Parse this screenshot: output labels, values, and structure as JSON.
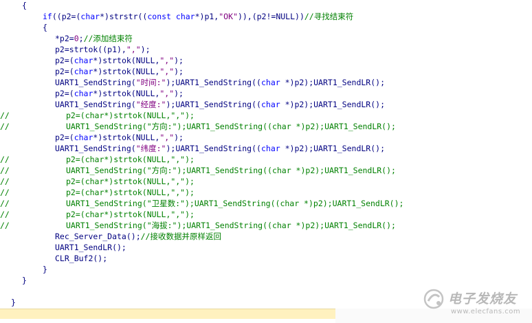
{
  "code_lines": [
    {
      "marker": "",
      "indent": 32,
      "segs": [
        {
          "t": "{",
          "c": "dim"
        }
      ]
    },
    {
      "marker": "",
      "indent": 62,
      "segs": [
        {
          "t": "if",
          "c": "kw"
        },
        {
          "t": "((p2=(",
          "c": "dim"
        },
        {
          "t": "char",
          "c": "kw"
        },
        {
          "t": "*)strstr((",
          "c": "dim"
        },
        {
          "t": "const char",
          "c": "kw"
        },
        {
          "t": "*)p1,",
          "c": "dim"
        },
        {
          "t": "\"OK\"",
          "c": "str"
        },
        {
          "t": ")),(p2!=NULL))",
          "c": "dim"
        },
        {
          "t": "//寻找结束符",
          "c": "cm"
        }
      ]
    },
    {
      "marker": "",
      "indent": 62,
      "segs": [
        {
          "t": "{",
          "c": "dim"
        }
      ]
    },
    {
      "marker": "",
      "indent": 80,
      "segs": [
        {
          "t": "*p2=",
          "c": "dim"
        },
        {
          "t": "0",
          "c": "str"
        },
        {
          "t": ";",
          "c": "dim"
        },
        {
          "t": "//添加结束符",
          "c": "cm"
        }
      ]
    },
    {
      "marker": "",
      "indent": 80,
      "segs": [
        {
          "t": "p2=strtok((p1),",
          "c": "dim"
        },
        {
          "t": "\",\"",
          "c": "str"
        },
        {
          "t": ");",
          "c": "dim"
        }
      ]
    },
    {
      "marker": "",
      "indent": 80,
      "segs": [
        {
          "t": "p2=(",
          "c": "dim"
        },
        {
          "t": "char",
          "c": "kw"
        },
        {
          "t": "*)strtok(NULL,",
          "c": "dim"
        },
        {
          "t": "\",\"",
          "c": "str"
        },
        {
          "t": ");",
          "c": "dim"
        }
      ]
    },
    {
      "marker": "",
      "indent": 80,
      "segs": [
        {
          "t": "p2=(",
          "c": "dim"
        },
        {
          "t": "char",
          "c": "kw"
        },
        {
          "t": "*)strtok(NULL,",
          "c": "dim"
        },
        {
          "t": "\",\"",
          "c": "str"
        },
        {
          "t": ");",
          "c": "dim"
        }
      ]
    },
    {
      "marker": "",
      "indent": 80,
      "segs": [
        {
          "t": "UART1_SendString(",
          "c": "dim"
        },
        {
          "t": "\"时间:\"",
          "c": "str"
        },
        {
          "t": ");UART1_SendString((",
          "c": "dim"
        },
        {
          "t": "char",
          "c": "kw"
        },
        {
          "t": " *)p2);UART1_SendLR();",
          "c": "dim"
        }
      ]
    },
    {
      "marker": "",
      "indent": 80,
      "segs": [
        {
          "t": "p2=(",
          "c": "dim"
        },
        {
          "t": "char",
          "c": "kw"
        },
        {
          "t": "*)strtok(NULL,",
          "c": "dim"
        },
        {
          "t": "\",\"",
          "c": "str"
        },
        {
          "t": ");",
          "c": "dim"
        }
      ]
    },
    {
      "marker": "",
      "indent": 80,
      "segs": [
        {
          "t": "UART1_SendString(",
          "c": "dim"
        },
        {
          "t": "\"经度:\"",
          "c": "str"
        },
        {
          "t": ");UART1_SendString((",
          "c": "dim"
        },
        {
          "t": "char",
          "c": "kw"
        },
        {
          "t": " *)p2);UART1_SendLR();",
          "c": "dim"
        }
      ]
    },
    {
      "marker": "//",
      "indent": 96,
      "segs": [
        {
          "t": "p2=(char*)strtok(NULL,\",\");",
          "c": "cm"
        }
      ]
    },
    {
      "marker": "//",
      "indent": 96,
      "segs": [
        {
          "t": "UART1_SendString(\"方向:\");UART1_SendString((char *)p2);UART1_SendLR();",
          "c": "cm"
        }
      ]
    },
    {
      "marker": "",
      "indent": 80,
      "segs": [
        {
          "t": "p2=(",
          "c": "dim"
        },
        {
          "t": "char",
          "c": "kw"
        },
        {
          "t": "*)strtok(NULL,",
          "c": "dim"
        },
        {
          "t": "\",\"",
          "c": "str"
        },
        {
          "t": ");",
          "c": "dim"
        }
      ]
    },
    {
      "marker": "",
      "indent": 80,
      "segs": [
        {
          "t": "UART1_SendString(",
          "c": "dim"
        },
        {
          "t": "\"纬度:\"",
          "c": "str"
        },
        {
          "t": ");UART1_SendString((",
          "c": "dim"
        },
        {
          "t": "char",
          "c": "kw"
        },
        {
          "t": " *)p2);UART1_SendLR();",
          "c": "dim"
        }
      ]
    },
    {
      "marker": "//",
      "indent": 96,
      "segs": [
        {
          "t": "p2=(char*)strtok(NULL,\",\");",
          "c": "cm"
        }
      ]
    },
    {
      "marker": "//",
      "indent": 96,
      "segs": [
        {
          "t": "UART1_SendString(\"方向:\");UART1_SendString((char *)p2);UART1_SendLR();",
          "c": "cm"
        }
      ]
    },
    {
      "marker": "//",
      "indent": 96,
      "segs": [
        {
          "t": "p2=(char*)strtok(NULL,\",\");",
          "c": "cm"
        }
      ]
    },
    {
      "marker": "//",
      "indent": 96,
      "segs": [
        {
          "t": "p2=(char*)strtok(NULL,\",\");",
          "c": "cm"
        }
      ]
    },
    {
      "marker": "//",
      "indent": 96,
      "segs": [
        {
          "t": "UART1_SendString(\"卫星数:\");UART1_SendString((char *)p2);UART1_SendLR();",
          "c": "cm"
        }
      ]
    },
    {
      "marker": "//",
      "indent": 96,
      "segs": [
        {
          "t": "p2=(char*)strtok(NULL,\",\");",
          "c": "cm"
        }
      ]
    },
    {
      "marker": "//",
      "indent": 96,
      "segs": [
        {
          "t": "UART1_SendString(\"海拔:\");UART1_SendString((char *)p2);UART1_SendLR();",
          "c": "cm"
        }
      ]
    },
    {
      "marker": "",
      "indent": 80,
      "segs": [
        {
          "t": "Rec_Server_Data();",
          "c": "dim"
        },
        {
          "t": "//接收数据并原样返回",
          "c": "cm"
        }
      ]
    },
    {
      "marker": "",
      "indent": 80,
      "segs": [
        {
          "t": "UART1_SendLR();",
          "c": "dim"
        }
      ]
    },
    {
      "marker": "",
      "indent": 80,
      "segs": [
        {
          "t": "CLR_Buf2();",
          "c": "dim"
        }
      ]
    },
    {
      "marker": "",
      "indent": 62,
      "segs": [
        {
          "t": "}",
          "c": "dim"
        }
      ]
    },
    {
      "marker": "",
      "indent": 32,
      "segs": [
        {
          "t": "}",
          "c": "dim"
        }
      ]
    },
    {
      "marker": "",
      "indent": 0,
      "segs": []
    },
    {
      "marker": "",
      "indent": 16,
      "segs": [
        {
          "t": "}",
          "c": "dim"
        }
      ]
    }
  ],
  "watermark": {
    "title": "电子发烧友",
    "url": "www.elecfans.com"
  },
  "colors": {
    "keyword": "#0000ff",
    "string": "#800080",
    "comment": "#008000",
    "text": "#000080"
  }
}
